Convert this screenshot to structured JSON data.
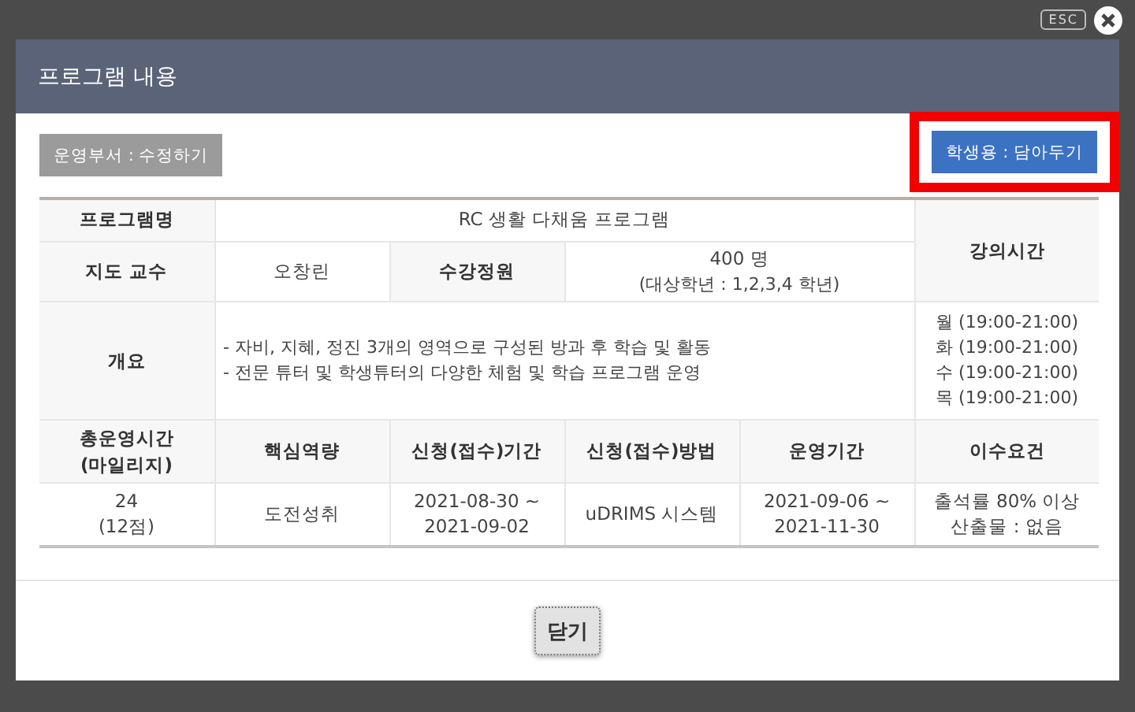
{
  "overlay": {
    "esc_label": "ESC"
  },
  "dialog": {
    "title": "프로그램 내용"
  },
  "actions": [
    {
      "label": "운영부서 : 수정하기",
      "kind": "secondary",
      "highlighted": false
    },
    {
      "label": "학생용 : 담아두기",
      "kind": "primary",
      "highlighted": true
    }
  ],
  "details": {
    "program_name": {
      "label": "프로그램명",
      "value": "RC 생활 다채움 프로그램"
    },
    "professor": {
      "label": "지도 교수",
      "value": "오창린"
    },
    "capacity": {
      "label": "수강정원",
      "lines": [
        "400 명",
        "(대상학년 : 1,2,3,4 학년)"
      ]
    },
    "lecture_time": {
      "label": "강의시간",
      "lines": [
        "월 (19:00-21:00)",
        "화 (19:00-21:00)",
        "수 (19:00-21:00)",
        "목 (19:00-21:00)"
      ]
    },
    "overview": {
      "label": "개요",
      "lines": [
        "- 자비, 지혜, 정진 3개의 영역으로 구성된 방과 후 학습 및 활동",
        "- 전문 튜터 및 학생튜터의 다양한 체험 및 학습 프로그램 운영"
      ]
    }
  },
  "summary": {
    "columns": [
      [
        "총운영시간",
        "(마일리지)"
      ],
      [
        "핵심역량"
      ],
      [
        "신청(접수)기간"
      ],
      [
        "신청(접수)방법"
      ],
      [
        "운영기간"
      ],
      [
        "이수요건"
      ]
    ],
    "values": [
      [
        "24",
        "(12점)"
      ],
      [
        "도전성취"
      ],
      [
        "2021-08-30 ~",
        "2021-09-02"
      ],
      [
        "uDRIMS 시스템"
      ],
      [
        "2021-09-06 ~",
        "2021-11-30"
      ],
      [
        "출석률 80% 이상",
        "산출물 : 없음"
      ]
    ]
  },
  "footer": {
    "close_label": "닫기"
  }
}
